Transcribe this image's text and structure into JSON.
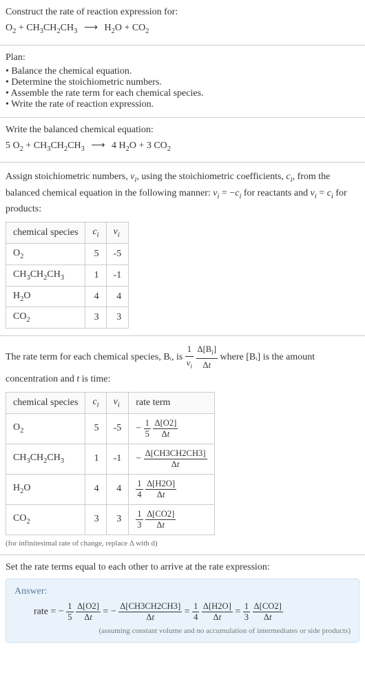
{
  "header": {
    "title": "Construct the rate of reaction expression for:",
    "equation": "O₂ + CH₃CH₂CH₃  ⟶  H₂O + CO₂"
  },
  "plan": {
    "title": "Plan:",
    "items": [
      "Balance the chemical equation.",
      "Determine the stoichiometric numbers.",
      "Assemble the rate term for each chemical species.",
      "Write the rate of reaction expression."
    ]
  },
  "balanced": {
    "title": "Write the balanced chemical equation:",
    "equation": "5 O₂ + CH₃CH₂CH₃  ⟶  4 H₂O + 3 CO₂"
  },
  "stoich": {
    "intro": "Assign stoichiometric numbers, νᵢ, using the stoichiometric coefficients, cᵢ, from the balanced chemical equation in the following manner: νᵢ = −cᵢ for reactants and νᵢ = cᵢ for products:",
    "headers": [
      "chemical species",
      "cᵢ",
      "νᵢ"
    ],
    "rows": [
      {
        "species": "O₂",
        "c": "5",
        "v": "-5"
      },
      {
        "species": "CH₃CH₂CH₃",
        "c": "1",
        "v": "-1"
      },
      {
        "species": "H₂O",
        "c": "4",
        "v": "4"
      },
      {
        "species": "CO₂",
        "c": "3",
        "v": "3"
      }
    ]
  },
  "rateterm": {
    "intro_a": "The rate term for each chemical species, Bᵢ, is ",
    "intro_b": " where [Bᵢ] is the amount concentration and ",
    "intro_c": " is time:",
    "t_var": "t",
    "headers": [
      "chemical species",
      "cᵢ",
      "νᵢ",
      "rate term"
    ],
    "rows": [
      {
        "species": "O₂",
        "c": "5",
        "v": "-5",
        "sign": "−",
        "coef_top": "1",
        "coef_bot": "5",
        "delta": "Δ[O2]"
      },
      {
        "species": "CH₃CH₂CH₃",
        "c": "1",
        "v": "-1",
        "sign": "−",
        "coef_top": "",
        "coef_bot": "",
        "delta": "Δ[CH3CH2CH3]"
      },
      {
        "species": "H₂O",
        "c": "4",
        "v": "4",
        "sign": "",
        "coef_top": "1",
        "coef_bot": "4",
        "delta": "Δ[H2O]"
      },
      {
        "species": "CO₂",
        "c": "3",
        "v": "3",
        "sign": "",
        "coef_top": "1",
        "coef_bot": "3",
        "delta": "Δ[CO2]"
      }
    ],
    "note": "(for infinitesimal rate of change, replace Δ with d)"
  },
  "final": {
    "title": "Set the rate terms equal to each other to arrive at the rate expression:"
  },
  "answer": {
    "label": "Answer:",
    "prefix": "rate = ",
    "terms": [
      {
        "sign": "−",
        "coef_top": "1",
        "coef_bot": "5",
        "delta": "Δ[O2]"
      },
      {
        "sign": "−",
        "coef_top": "",
        "coef_bot": "",
        "delta": "Δ[CH3CH2CH3]"
      },
      {
        "sign": "",
        "coef_top": "1",
        "coef_bot": "4",
        "delta": "Δ[H2O]"
      },
      {
        "sign": "",
        "coef_top": "1",
        "coef_bot": "3",
        "delta": "Δ[CO2]"
      }
    ],
    "note": "(assuming constant volume and no accumulation of intermediates or side products)"
  },
  "frac_general": {
    "one": "1",
    "nu": "νᵢ",
    "dbi": "Δ[Bᵢ]",
    "dt": "Δt"
  }
}
